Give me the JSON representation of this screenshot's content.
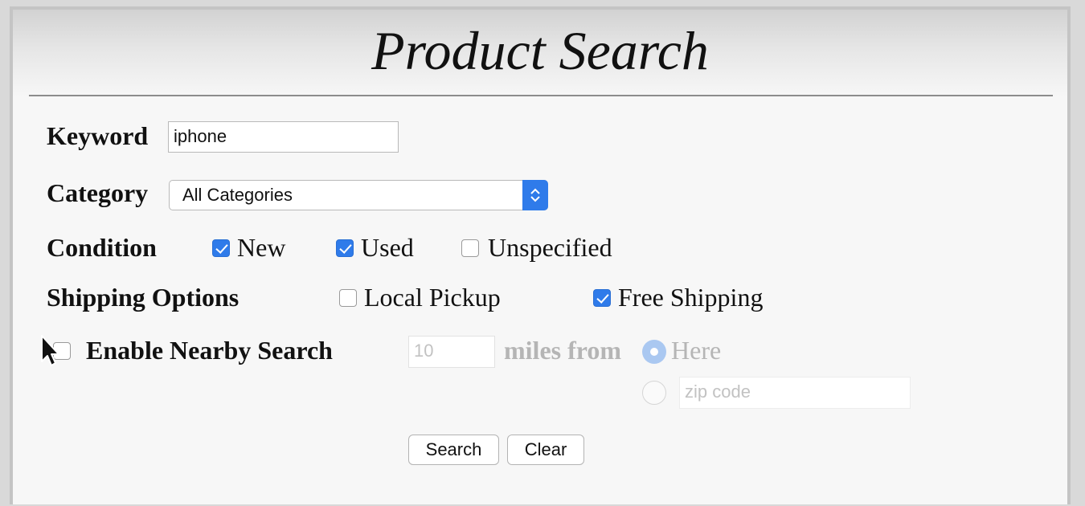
{
  "title": "Product Search",
  "keyword": {
    "label": "Keyword",
    "value": "iphone"
  },
  "category": {
    "label": "Category",
    "selected": "All Categories"
  },
  "condition": {
    "label": "Condition",
    "options": [
      {
        "label": "New",
        "checked": true
      },
      {
        "label": "Used",
        "checked": true
      },
      {
        "label": "Unspecified",
        "checked": false
      }
    ]
  },
  "shipping": {
    "label": "Shipping Options",
    "options": [
      {
        "label": "Local Pickup",
        "checked": false
      },
      {
        "label": "Free Shipping",
        "checked": true
      }
    ]
  },
  "nearby": {
    "label": "Enable Nearby Search",
    "checked": false,
    "distance_placeholder": "10",
    "miles_from": "miles from",
    "here_label": "Here",
    "zip_placeholder": "zip code"
  },
  "buttons": {
    "search": "Search",
    "clear": "Clear"
  },
  "colors": {
    "accent": "#2f7bea",
    "disabled_text": "#b5b5b5"
  }
}
